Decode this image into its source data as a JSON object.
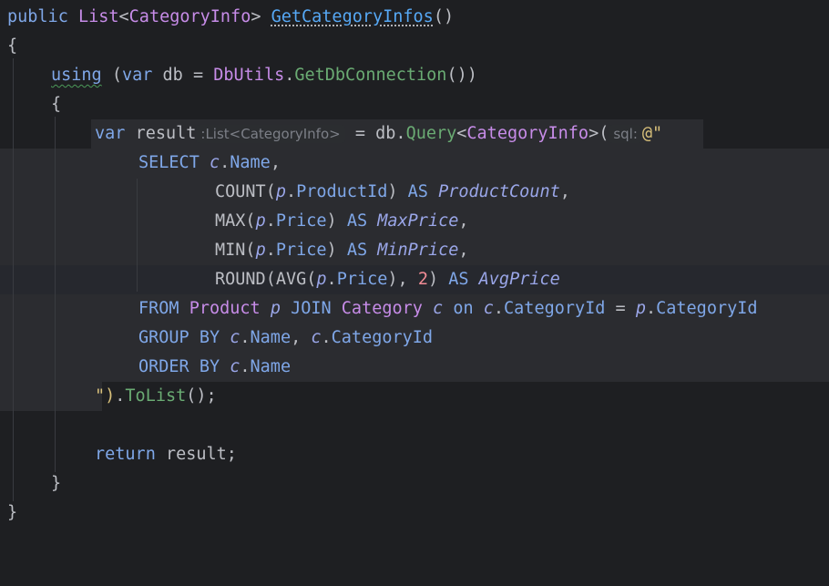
{
  "editor": {
    "method_signature": {
      "modifier": "public",
      "return_type": "List",
      "generic": "CategoryInfo",
      "method_name": "GetCategoryInfos",
      "params": "()"
    },
    "lines": {
      "open_brace": "{",
      "using_keyword": "using",
      "var_keyword": "var",
      "db_var": "db",
      "dbutils_class": "DbUtils",
      "get_connection": "GetDbConnection",
      "inner_open": "{",
      "result_var": "result",
      "type_hint": ":List<CategoryInfo>",
      "query_call": "Query",
      "param_hint": "sql:",
      "verbatim_start": "@\"",
      "close_string": "\")",
      "tolist": "ToList",
      "return_keyword": "return",
      "inner_close": "}",
      "outer_close": "}"
    },
    "sql": {
      "select": "SELECT",
      "c_alias": "c",
      "name_col": "Name",
      "count": "COUNT",
      "p_alias": "p",
      "product_id": "ProductId",
      "as": "AS",
      "product_count": "ProductCount",
      "max": "MAX",
      "price": "Price",
      "max_price": "MaxPrice",
      "min": "MIN",
      "min_price": "MinPrice",
      "round": "ROUND",
      "avg": "AVG",
      "two": "2",
      "avg_price": "AvgPrice",
      "from": "FROM",
      "product_table": "Product",
      "join": "JOIN",
      "category_table": "Category",
      "on": "on",
      "category_id": "CategoryId",
      "group_by": "GROUP BY",
      "order_by": "ORDER BY"
    }
  }
}
